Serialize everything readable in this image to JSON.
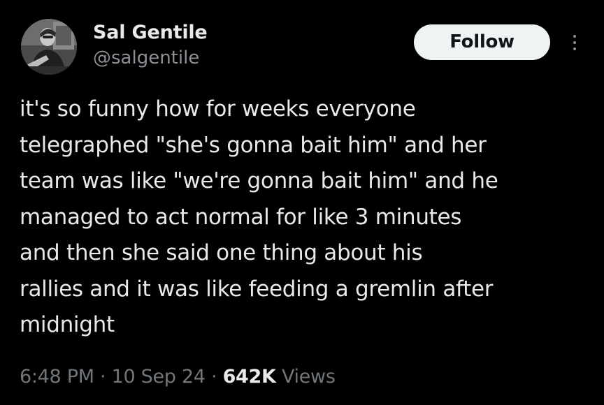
{
  "author": {
    "display_name": "Sal Gentile",
    "handle": "@salgentile",
    "avatar_icon": "user-photo-avatar"
  },
  "actions": {
    "follow_label": "Follow",
    "more_icon": "more-vertical-icon"
  },
  "tweet": {
    "text": "it's so funny how for weeks everyone\ntelegraphed \"she's gonna bait him\" and her\nteam was like \"we're gonna bait him\" and he\nmanaged to act normal for like 3 minutes\nand then she said one thing about his\nrallies and it was like feeding a gremlin after\nmidnight"
  },
  "meta": {
    "time": "6:48 PM",
    "separator": "·",
    "date": "10 Sep 24",
    "views_count": "642K",
    "views_label": "Views"
  },
  "colors": {
    "background": "#000000",
    "primary_text": "#e7e9ea",
    "secondary_text": "#71767b",
    "follow_button_bg": "#eff3f4"
  }
}
